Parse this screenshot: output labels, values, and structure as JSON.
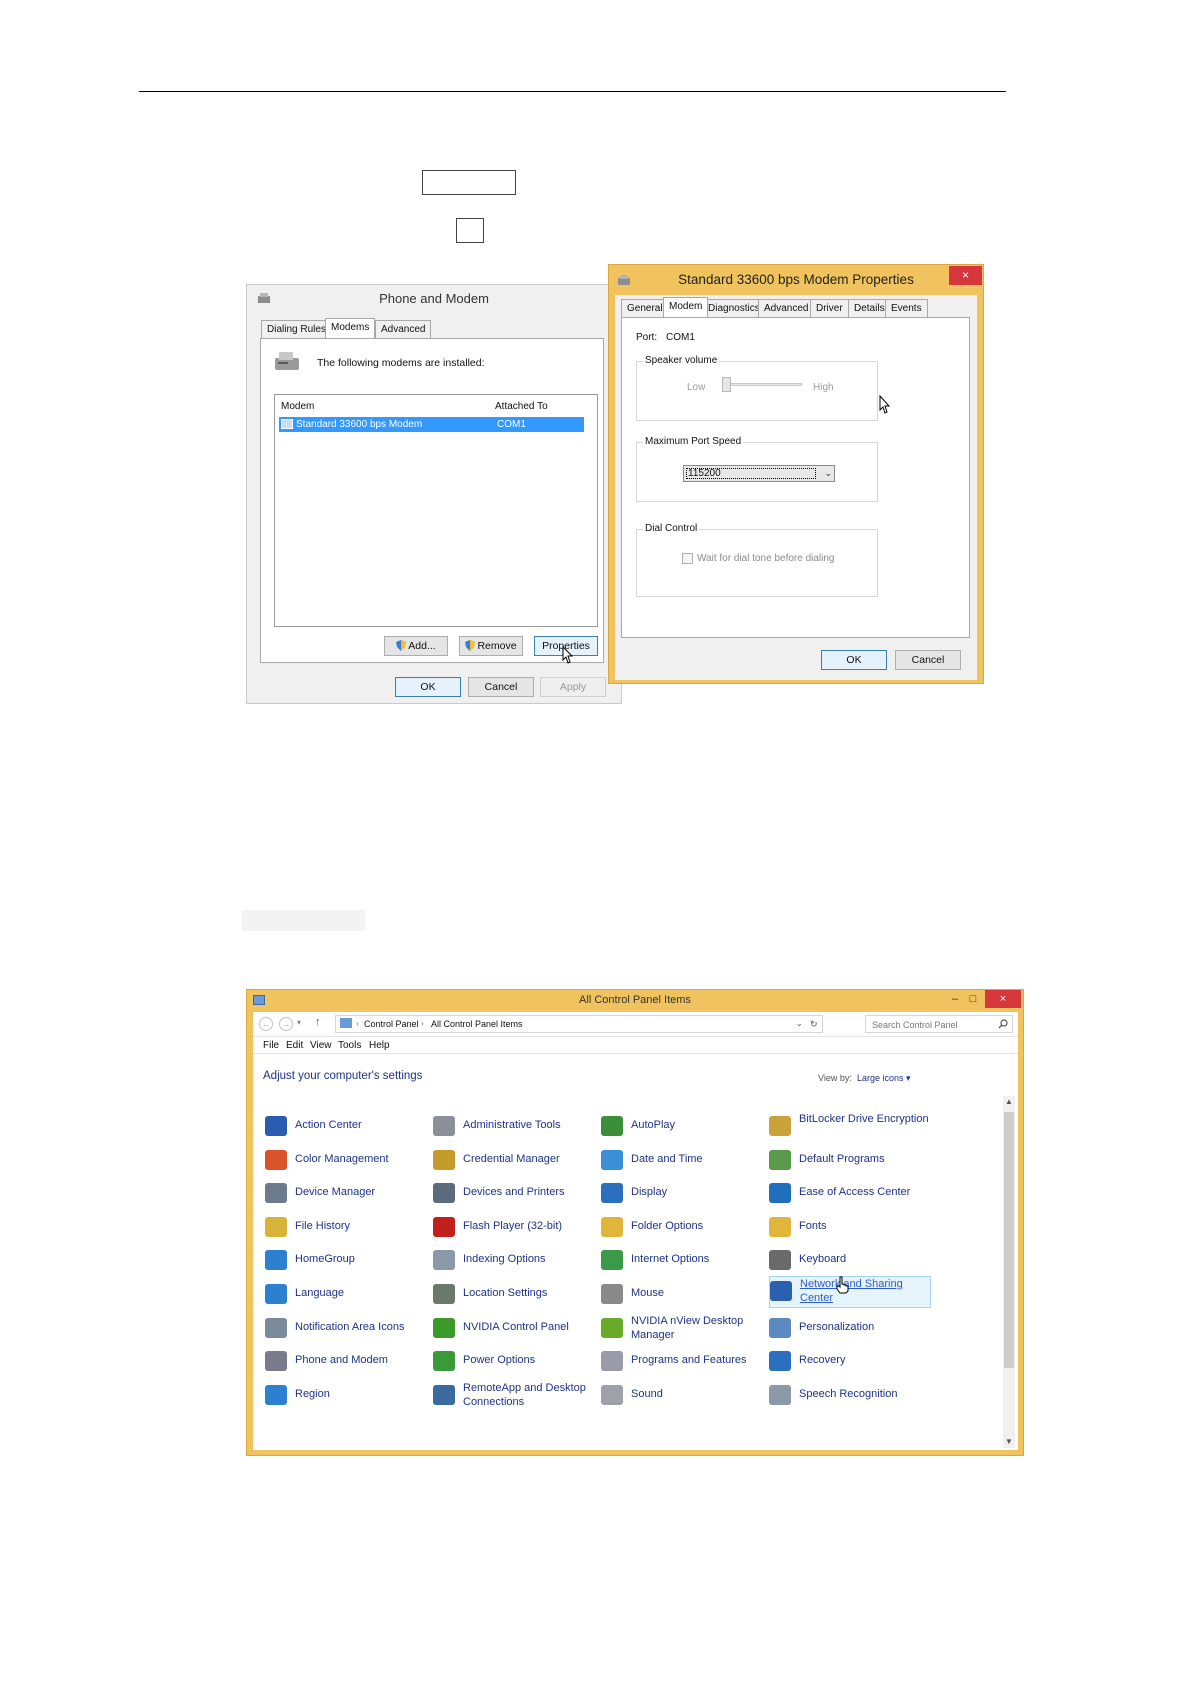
{
  "phone_modem": {
    "title": "Phone and Modem",
    "tabs": [
      "Dialing Rules",
      "Modems",
      "Advanced"
    ],
    "message": "The following modems are installed:",
    "columns": [
      "Modem",
      "Attached To"
    ],
    "rows": [
      {
        "modem": "Standard 33600 bps Modem",
        "attached": "COM1"
      }
    ],
    "buttons": {
      "add": "Add...",
      "remove": "Remove",
      "properties": "Properties",
      "ok": "OK",
      "cancel": "Cancel",
      "apply": "Apply"
    }
  },
  "modem_props": {
    "title": "Standard 33600 bps Modem Properties",
    "close": "×",
    "tabs": [
      "General",
      "Modem",
      "Diagnostics",
      "Advanced",
      "Driver",
      "Details",
      "Events"
    ],
    "port_label": "Port:",
    "port_value": "COM1",
    "speaker_group": "Speaker volume",
    "low": "Low",
    "high": "High",
    "speed_group": "Maximum Port Speed",
    "speed_value": "115200",
    "dial_group": "Dial Control",
    "dial_checkbox": "Wait for dial tone before dialing",
    "buttons": {
      "ok": "OK",
      "cancel": "Cancel"
    }
  },
  "control_panel": {
    "title": "All Control Panel Items",
    "breadcrumb": [
      "Control Panel",
      "All Control Panel Items"
    ],
    "search_placeholder": "Search Control Panel",
    "menu": [
      "File",
      "Edit",
      "View",
      "Tools",
      "Help"
    ],
    "heading": "Adjust your computer's settings",
    "view_by_label": "View by:",
    "view_by_value": "Large icons",
    "items": [
      [
        "Action Center",
        "Administrative Tools",
        "AutoPlay",
        "BitLocker Drive Encryption"
      ],
      [
        "Color Management",
        "Credential Manager",
        "Date and Time",
        "Default Programs"
      ],
      [
        "Device Manager",
        "Devices and Printers",
        "Display",
        "Ease of Access Center"
      ],
      [
        "File History",
        "Flash Player (32-bit)",
        "Folder Options",
        "Fonts"
      ],
      [
        "HomeGroup",
        "Indexing Options",
        "Internet Options",
        "Keyboard"
      ],
      [
        "Language",
        "Location Settings",
        "Mouse",
        "Network and Sharing Center"
      ],
      [
        "Notification Area Icons",
        "NVIDIA Control Panel",
        "NVIDIA nView Desktop Manager",
        "Personalization"
      ],
      [
        "Phone and Modem",
        "Power Options",
        "Programs and Features",
        "Recovery"
      ],
      [
        "Region",
        "RemoteApp and Desktop Connections",
        "Sound",
        "Speech Recognition"
      ]
    ],
    "icon_colors": [
      [
        "#2a5db0",
        "#8a8f9a",
        "#3b8f3b",
        "#c9a23a"
      ],
      [
        "#d9542b",
        "#c49a2a",
        "#3a8fd6",
        "#5a9a4a"
      ],
      [
        "#6b7b8c",
        "#5b6b7b",
        "#2d6fbf",
        "#1f6fbf"
      ],
      [
        "#d8b33a",
        "#c21f1f",
        "#e0b63a",
        "#e0b63a"
      ],
      [
        "#2d7fd0",
        "#8a9aa8",
        "#3a9a4a",
        "#6a6a6a"
      ],
      [
        "#2d7fd0",
        "#6a7a6a",
        "#8a8a8a",
        "#2d5fb0"
      ],
      [
        "#7a8a9a",
        "#3a9a2a",
        "#6aaa2a",
        "#5a8ac0"
      ],
      [
        "#7a7a8a",
        "#3a9a3a",
        "#9a9aa8",
        "#2d6fbf"
      ],
      [
        "#2d7fd0",
        "#3a6aa0",
        "#a0a0a8",
        "#8a9aa8"
      ]
    ]
  }
}
